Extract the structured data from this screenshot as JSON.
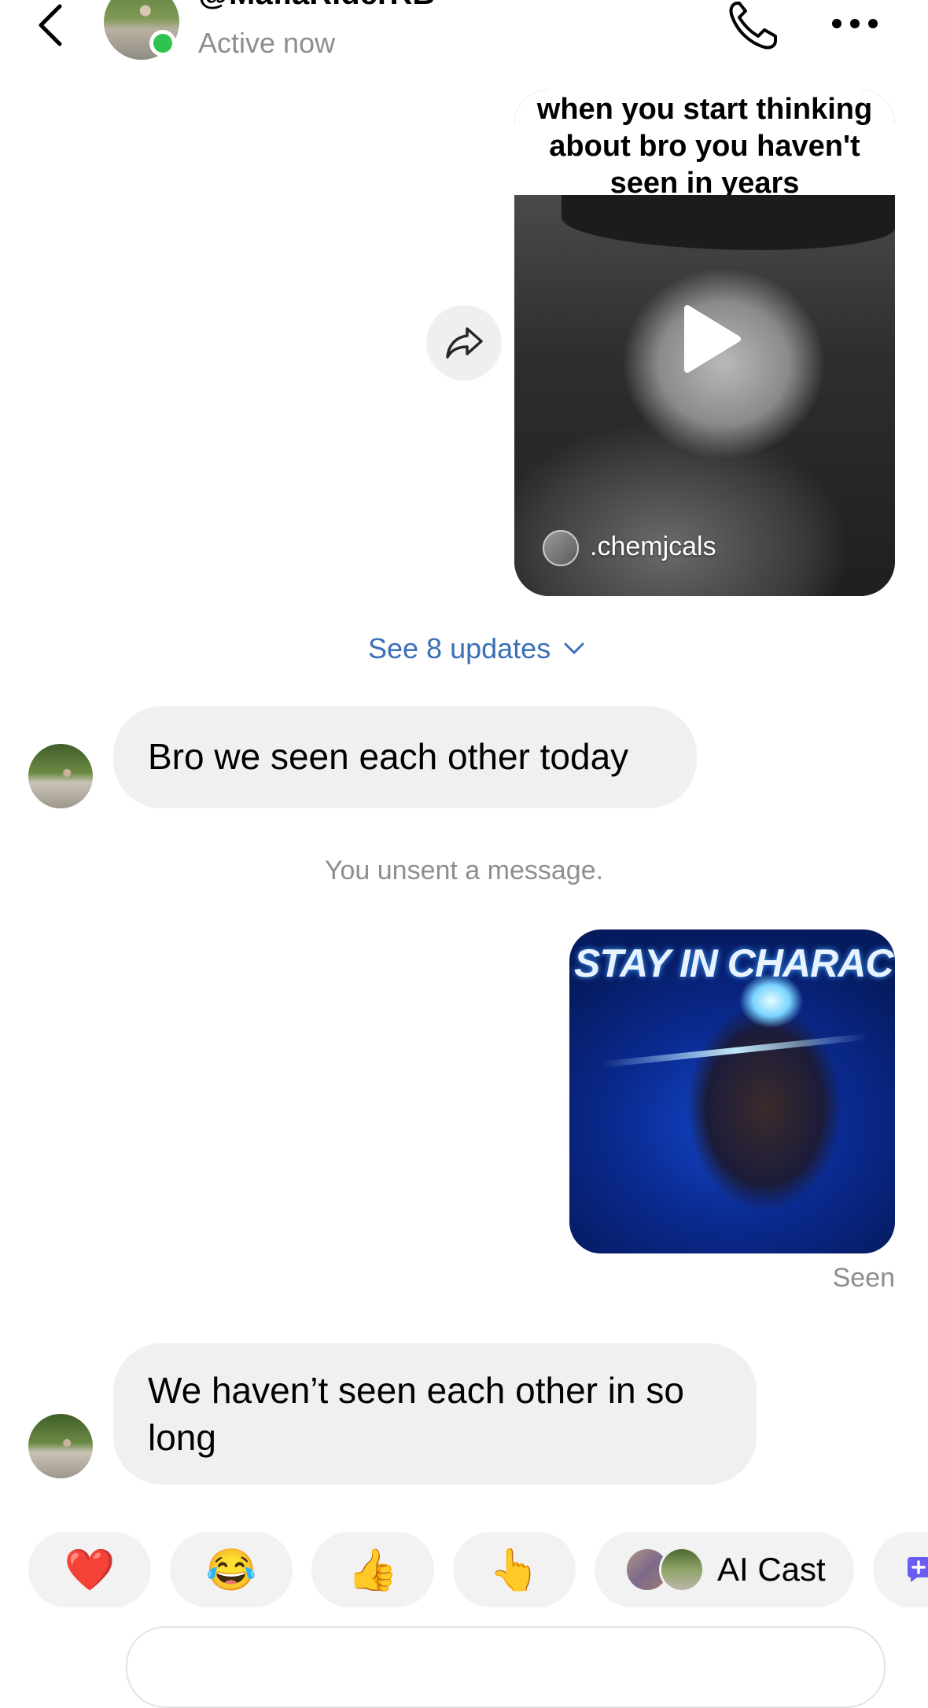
{
  "header": {
    "handle": "@MafiaRiderRB",
    "status": "Active now",
    "icons": [
      "back-icon",
      "phone-icon",
      "more-icon"
    ]
  },
  "reel": {
    "caption": "when you start thinking about bro you haven't seen in years",
    "source": ".chemjcals",
    "icons": [
      "play-icon",
      "share-icon"
    ]
  },
  "see_updates": "See 8 updates",
  "messages": [
    {
      "from": "contact",
      "text": "Bro we seen each other today"
    },
    {
      "from": "system",
      "text": "You unsent a message."
    },
    {
      "from": "me",
      "type": "image",
      "image_text": "STAY IN CHARACTER"
    },
    {
      "from": "contact",
      "text": "We haven’t seen each other in so long"
    }
  ],
  "seen_label": "Seen",
  "reactions": {
    "heart": "❤️",
    "laugh": "😂",
    "thumbs_up": "👍",
    "pointing": "👆",
    "ai_cast": "AI Cast"
  },
  "colors": {
    "online": "#2fc44f",
    "link": "#3b6fb6",
    "bubble": "#f0f0f0",
    "muted": "#8e8e8e"
  }
}
